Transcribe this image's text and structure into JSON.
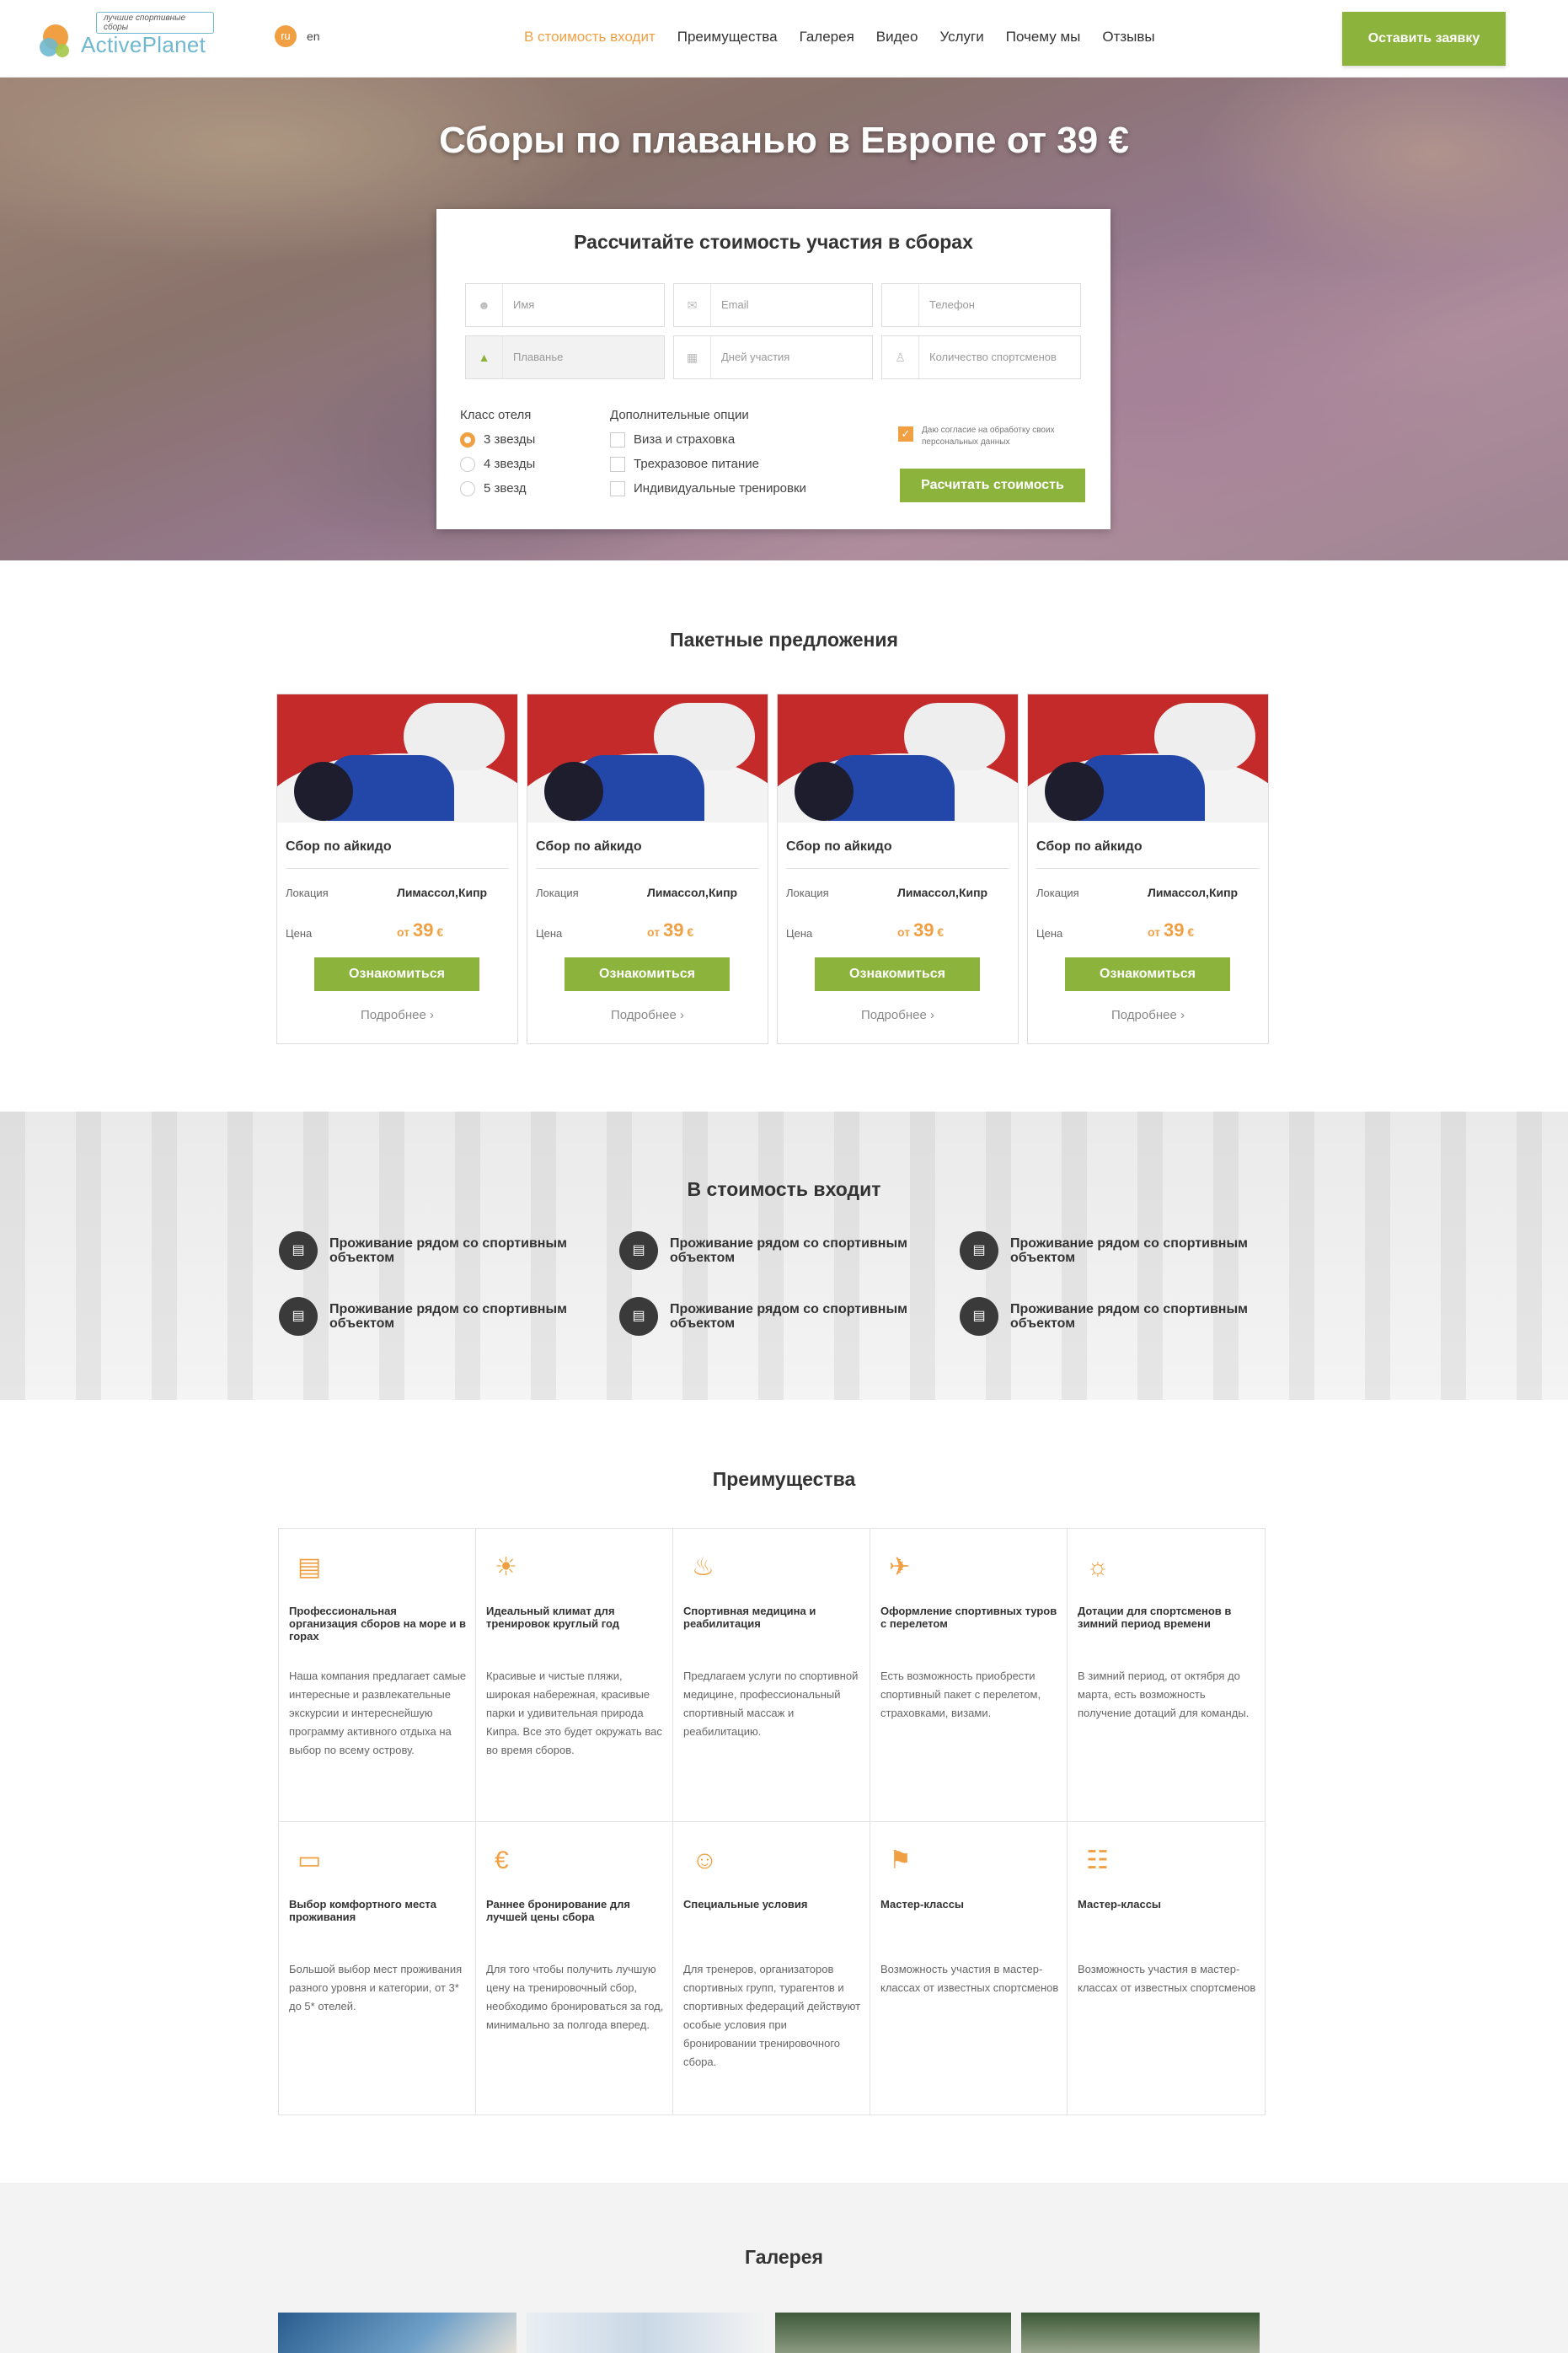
{
  "header": {
    "logo_text": "ActivePlanet",
    "logo_tagline": "лучшие спортивные сборы",
    "lang_ru": "ru",
    "lang_en": "en",
    "nav": [
      "В стоимость входит",
      "Преимущества",
      "Галерея",
      "Видео",
      "Услуги",
      "Почему мы",
      "Отзывы"
    ],
    "cta": "Оставить заявку"
  },
  "hero": {
    "title": "Сборы по плаванью в Европе от 39 €",
    "form": {
      "title": "Рассчитайте стоимость участия в сборах",
      "name": "Имя",
      "email": "Email",
      "phone": "Телефон",
      "sport": "Плаванье",
      "days": "Дней участия",
      "athletes": "Количество спортсменов",
      "hotel_label": "Класс отеля",
      "hotel_options": [
        "3 звезды",
        "4 звезды",
        "5 звезд"
      ],
      "hotel_selected": "3 звезды",
      "extra_label": "Дополнительные опции",
      "extra_options": [
        "Виза и страховка",
        "Трехразовое питание",
        "Индивидуальные тренировки"
      ],
      "consent": "Даю согласие на обработку своих персональных данных",
      "submit": "Расчитать стоимость"
    }
  },
  "packages": {
    "title": "Пакетные предложения",
    "loc_label": "Локация",
    "price_label": "Цена",
    "items": [
      {
        "name": "Сбор по айкидо",
        "location": "Лимассол,Кипр",
        "price_from": "от",
        "price": "39",
        "currency": "€",
        "button": "Ознакомиться",
        "more": "Подробнее"
      },
      {
        "name": "Сбор по айкидо",
        "location": "Лимассол,Кипр",
        "price_from": "от",
        "price": "39",
        "currency": "€",
        "button": "Ознакомиться",
        "more": "Подробнее"
      },
      {
        "name": "Сбор по айкидо",
        "location": "Лимассол,Кипр",
        "price_from": "от",
        "price": "39",
        "currency": "€",
        "button": "Ознакомиться",
        "more": "Подробнее"
      },
      {
        "name": "Сбор по айкидо",
        "location": "Лимассол,Кипр",
        "price_from": "от",
        "price": "39",
        "currency": "€",
        "button": "Ознакомиться",
        "more": "Подробнее"
      }
    ]
  },
  "included": {
    "title": "В стоимость входит",
    "items": [
      "Проживание рядом со спортивным объектом",
      "Проживание рядом со спортивным объектом",
      "Проживание рядом со спортивным объектом",
      "Проживание рядом со спортивным объектом",
      "Проживание рядом со спортивным объектом",
      "Проживание рядом со спортивным объектом"
    ]
  },
  "advantages": {
    "title": "Преимущества",
    "items": [
      {
        "icon": "stadium-icon",
        "title": "Профессиональная организация сборов на море и в горах",
        "text": "Наша компания предлагает самые интересные и развлекательные экскурсии и интереснейшую программу активного отдыха на выбор по всему острову."
      },
      {
        "icon": "palm-island-icon",
        "title": "Идеальный климат для тренировок круглый год",
        "text": "Красивые и чистые пляжи, широкая набережная, красивые парки и удивительная природа Кипра. Все это будет окружать вас во время сборов."
      },
      {
        "icon": "massage-icon",
        "title": "Спортивная медицина и реабилитация",
        "text": "Предлагаем услуги по спортивной медицине, профессиональный спортивный массаж и реабилитацию."
      },
      {
        "icon": "airplane-icon",
        "title": "Оформление спортивных туров с перелетом",
        "text": "Есть возможность приобрести спортивный пакет с перелетом, страховками, визами."
      },
      {
        "icon": "lightbulb-icon",
        "title": "Дотации для спортсменов в зимний период времени",
        "text": "В зимний период, от октября до марта, есть возможность получение дотаций для команды."
      },
      {
        "icon": "bed-icon",
        "title": "Выбор комфортного места проживания",
        "text": "Большой выбор мест проживания разного уровня и категории, от 3* до 5* отелей."
      },
      {
        "icon": "euro-icon",
        "title": "Раннее бронирование для лучшей цены сбора",
        "text": "Для того чтобы получить лучшую цену на тренировочный сбор, необходимо бронироваться за год, минимально за полгода вперед."
      },
      {
        "icon": "smile-icon",
        "title": "Специальные условия",
        "text": "Для тренеров, организаторов спортивных групп, турагентов и спортивных федераций действуют особые условия при бронировании тренировочного сбора."
      },
      {
        "icon": "athlete-icon",
        "title": "Мастер-классы",
        "text": "Возможность участия в мастер-классах от известных спортсменов"
      },
      {
        "icon": "document-icon",
        "title": "Мастер-классы",
        "text": "Возможность участия в мастер-классах от известных спортсменов"
      }
    ]
  },
  "gallery": {
    "title": "Галерея"
  },
  "colors": {
    "accent_orange": "#f0a042",
    "accent_green": "#8cb43c",
    "logo_blue": "#6fb8cf"
  }
}
